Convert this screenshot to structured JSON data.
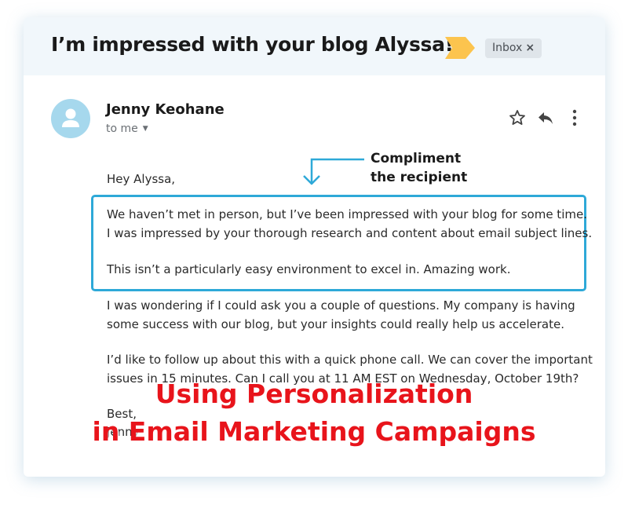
{
  "email": {
    "subject": "I’m impressed with your blog Alyssa!",
    "label_icon": "label-arrow-icon",
    "label_color": "#fcc44e",
    "folder_chip": {
      "label": "Inbox",
      "remove": "×"
    },
    "sender": {
      "name": "Jenny Keohane",
      "avatar_icon": "person-icon",
      "recipient": "to me",
      "recipient_icon": "caret-down-icon"
    },
    "actions": [
      {
        "icon": "star-icon"
      },
      {
        "icon": "reply-icon"
      },
      {
        "icon": "more-vert-icon"
      }
    ],
    "body": {
      "greeting": "Hey Alyssa,",
      "highlighted_paragraph_1": "We haven’t met in person, but I’ve been impressed with your blog for some time.\nI was impressed by your thorough research and content about email subject lines.",
      "highlighted_paragraph_2": "This isn’t a particularly easy environment to excel in. Amazing work.",
      "paragraph_3": "I was wondering if I could ask you a couple of questions. My company is having\nsome success with our blog, but your insights could really help us accelerate.",
      "paragraph_4": "I’d like to follow up about this with a quick phone call. We can cover the important\nissues in 15 minutes. Can I call you at 11 AM EST on Wednesday, October 19th?",
      "signoff": "Best,",
      "signature": "Jenny"
    }
  },
  "annotation": {
    "text": "Compliment\nthe recipient",
    "highlight_color": "#2ea9d8"
  },
  "overlay": {
    "title": "Using Personalization\nin Email Marketing Campaigns",
    "color": "#e8141b"
  }
}
